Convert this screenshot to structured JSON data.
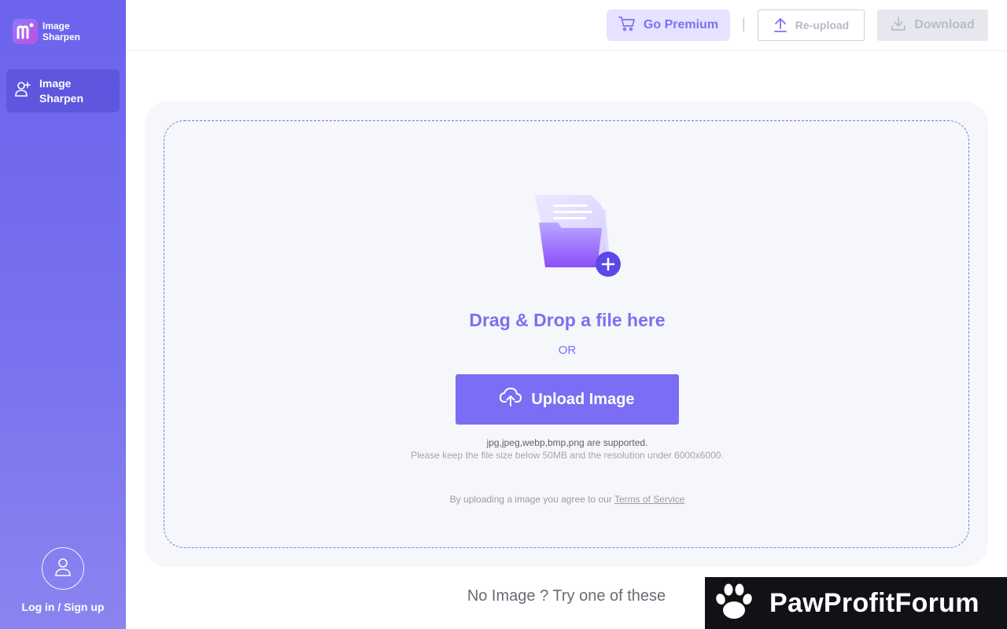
{
  "app": {
    "logo_text": "Image Sharpen"
  },
  "sidebar": {
    "items": [
      {
        "label": "Image Sharpen",
        "icon": "user-add-icon",
        "active": true
      }
    ],
    "login_label": "Log in / Sign up"
  },
  "toolbar": {
    "premium_label": "Go Premium",
    "separator": "|",
    "reupload_label": "Re-upload",
    "download_label": "Download"
  },
  "upload": {
    "title": "Drag & Drop a file here",
    "or_text": "OR",
    "button_label": "Upload Image",
    "formats": "jpg,jpeg,webp,bmp,png are supported.",
    "limits": "Please keep the file size below 50MB and the resolution under 6000x6000.",
    "terms_prefix": "By uploading a image you agree to our ",
    "terms_link": "Terms of Service"
  },
  "samples": {
    "prompt": "No Image ? Try one of these"
  },
  "watermark": {
    "text": "PawProfitForum"
  },
  "colors": {
    "accent": "#7b6df4",
    "sidebar": "#6b63ec",
    "premium_bg": "#e6e2ff"
  }
}
